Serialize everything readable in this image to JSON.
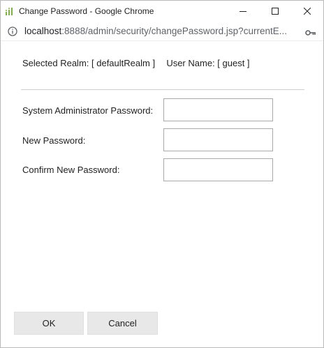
{
  "window": {
    "title": "Change Password - Google Chrome",
    "icons": {
      "app": "app-logo-icon",
      "minimize": "minimize-icon",
      "maximize": "maximize-icon",
      "close": "close-icon"
    }
  },
  "addressbar": {
    "url_host": "localhost",
    "url_rest": ":8888/admin/security/changePassword.jsp?currentE...",
    "icons": {
      "info": "info-icon",
      "key": "key-icon"
    }
  },
  "form": {
    "selected_realm_label": "Selected Realm:",
    "selected_realm_value": "[ defaultRealm ]",
    "user_name_label": "User Name:",
    "user_name_value": "[ guest ]",
    "fields": [
      {
        "label": "System Administrator Password:",
        "value": ""
      },
      {
        "label": "New Password:",
        "value": ""
      },
      {
        "label": "Confirm New Password:",
        "value": ""
      }
    ]
  },
  "buttons": {
    "ok_label": "OK",
    "cancel_label": "Cancel"
  },
  "colors": {
    "app_icon": "#7cb342",
    "button_bg": "#e8e8e8",
    "divider": "#cfcfcf"
  }
}
